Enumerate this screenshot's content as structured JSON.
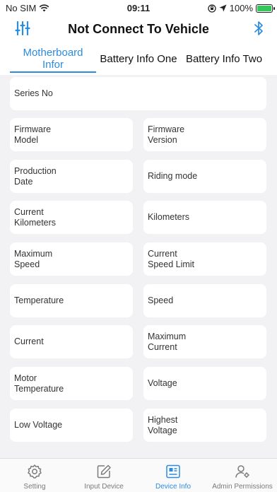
{
  "status": {
    "carrier": "No SIM",
    "time": "09:11",
    "battery": "100%",
    "battery_level": 1.0
  },
  "header": {
    "title": "Not Connect To Vehicle",
    "settings_icon": "sliders-icon",
    "bluetooth_icon": "bluetooth-icon"
  },
  "tabs": [
    {
      "label_line1": "Motherboard",
      "label_line2": "Infor",
      "active": true
    },
    {
      "label": "Battery Info One"
    },
    {
      "label": "Battery Info Two"
    }
  ],
  "fields": {
    "series_no": "Series No",
    "firmware_model_1": "Firmware",
    "firmware_model_2": "Model",
    "firmware_version_1": "Firmware",
    "firmware_version_2": "Version",
    "production_date_1": "Production",
    "production_date_2": "Date",
    "riding_mode": "Riding mode",
    "current_km_1": "Current",
    "current_km_2": "Kilometers",
    "kilometers": "Kilometers",
    "max_speed_1": "Maximum",
    "max_speed_2": "Speed",
    "speed_limit_1": "Current",
    "speed_limit_2": "Speed Limit",
    "temperature": "Temperature",
    "speed": "Speed",
    "current": "Current",
    "max_current_1": "Maximum",
    "max_current_2": "Current",
    "motor_temp_1": "Motor",
    "motor_temp_2": "Temperature",
    "voltage": "Voltage",
    "low_voltage": "Low Voltage",
    "highest_voltage_1": "Highest",
    "highest_voltage_2": "Voltage"
  },
  "tabbar": [
    {
      "label": "Setting",
      "icon": "gear-icon"
    },
    {
      "label": "Input Device",
      "icon": "edit-icon"
    },
    {
      "label": "Device Info",
      "icon": "device-info-icon",
      "active": true
    },
    {
      "label": "Admin Permissions",
      "icon": "admin-user-icon"
    }
  ],
  "colors": {
    "accent": "#2b8ce0",
    "background": "#f2f2f4",
    "card": "#ffffff",
    "battery": "#35c759"
  }
}
